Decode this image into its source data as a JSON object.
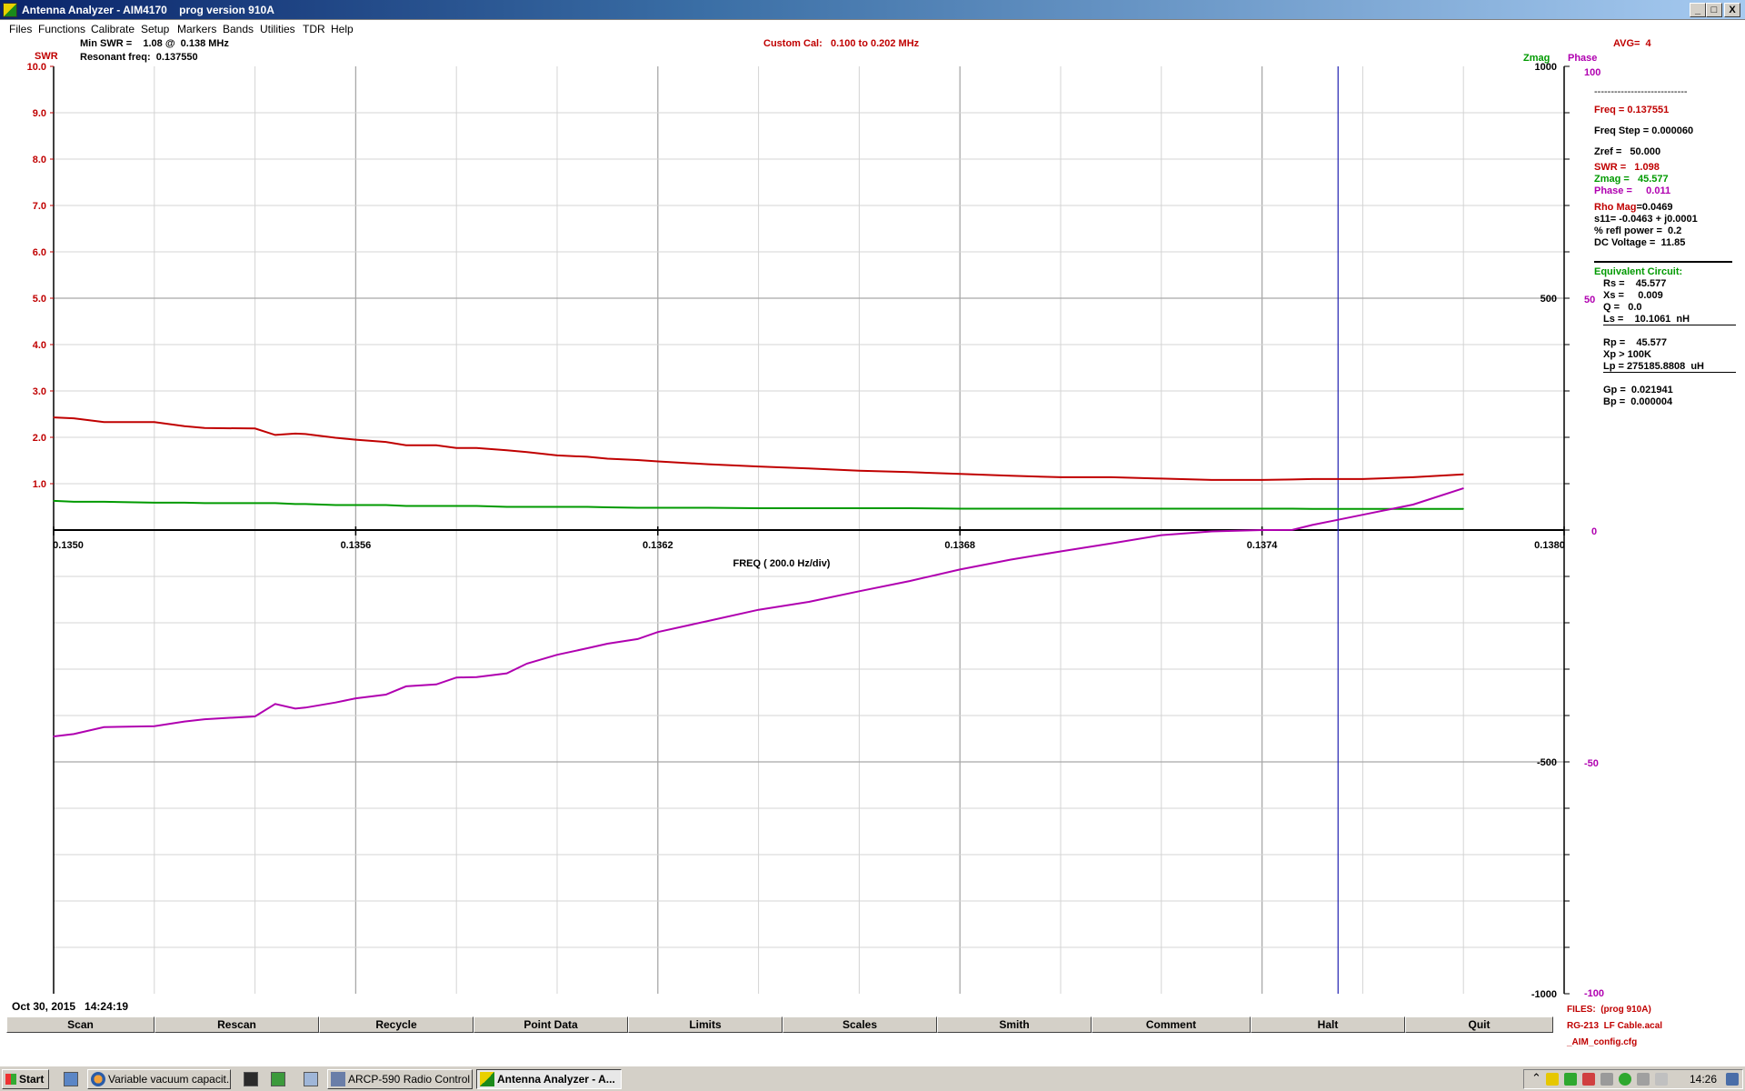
{
  "window": {
    "title": "Antenna Analyzer - AIM4170    prog version 910A",
    "minimize": "_",
    "maximize": "□",
    "close": "X"
  },
  "menu": [
    "Files",
    "Functions",
    "Calibrate",
    "Setup",
    "Markers",
    "Bands",
    "Utilities",
    "TDR",
    "Help"
  ],
  "header": {
    "min_swr": "Min SWR =    1.08 @  0.138 MHz",
    "resonant": "Resonant freq:  0.137550",
    "custom_cal": "Custom Cal:   0.100 to 0.202 MHz",
    "avg": "AVG=  4",
    "swr_axis": "SWR",
    "zmag_axis": "Zmag",
    "phase_axis": "Phase"
  },
  "readout": {
    "dashes": "----------------------------",
    "freq": "Freq = 0.137551",
    "freq_step": "Freq Step = 0.000060",
    "zref": "Zref =   50.000",
    "swr": "SWR =   1.098",
    "zmag": "Zmag =   45.577",
    "phase": "Phase =     0.011",
    "rho_label": "Rho Mag",
    "rho_value": "=0.0469",
    "s11": "s11= -0.0463 + j0.0001",
    "refl": "% refl power =  0.2",
    "dc": "DC Voltage =  11.85",
    "eq_title": "Equivalent Circuit:",
    "rs": "Rs =    45.577",
    "xs": "Xs =     0.009",
    "q": "Q =   0.0",
    "ls": "Ls =    10.1061  nH",
    "rp": "Rp =    45.577",
    "xp": "Xp > 100K",
    "lp": "Lp = 275185.8808  uH",
    "gp": "Gp =  0.021941",
    "bp": "Bp =  0.000004"
  },
  "files": {
    "title": "FILES:  (prog 910A)",
    "cal": "RG-213  LF Cable.acal",
    "cfg": "_AIM_config.cfg"
  },
  "timestamp": "Oct 30, 2015   14:24:19",
  "xlabel": "FREQ ( 200.0 Hz/div)",
  "buttons": [
    "Scan",
    "Rescan",
    "Recycle",
    "Point Data",
    "Limits",
    "Scales",
    "Smith",
    "Comment",
    "Halt",
    "Quit"
  ],
  "taskbar": {
    "start": "Start",
    "tasks": [
      "Variable vacuum capacit...",
      "ARCP-590 Radio Control ...",
      "Antenna Analyzer - A..."
    ],
    "clock": "14:26"
  },
  "colors": {
    "swr": "#c00000",
    "zmag": "#009a00",
    "phase": "#b000b0",
    "marker": "#2020b0",
    "grid": "#c8c8c8"
  },
  "chart_data": {
    "type": "line",
    "x": [
      0.135,
      0.13504,
      0.1351,
      0.1352,
      0.13526,
      0.1353,
      0.1354,
      0.13544,
      0.13548,
      0.1355,
      0.13556,
      0.1356,
      0.13566,
      0.1357,
      0.13576,
      0.1358,
      0.13584,
      0.1359,
      0.13594,
      0.136,
      0.13606,
      0.1361,
      0.13616,
      0.1362,
      0.1363,
      0.1364,
      0.1365,
      0.1366,
      0.1367,
      0.1368,
      0.1369,
      0.137,
      0.1371,
      0.1372,
      0.1373,
      0.1374,
      0.13746,
      0.1375,
      0.13755,
      0.1376,
      0.1377,
      0.1378
    ],
    "xlim": [
      0.135,
      0.138
    ],
    "xticks": [
      "0.1350",
      "0.1356",
      "0.1362",
      "0.1368",
      "0.1374",
      "0.1380"
    ],
    "series": [
      {
        "name": "SWR",
        "axis": "swr",
        "values": [
          2.43,
          2.41,
          2.33,
          2.33,
          2.24,
          2.2,
          2.19,
          2.05,
          2.08,
          2.07,
          1.99,
          1.95,
          1.9,
          1.83,
          1.83,
          1.77,
          1.77,
          1.72,
          1.68,
          1.61,
          1.58,
          1.54,
          1.51,
          1.48,
          1.42,
          1.37,
          1.33,
          1.28,
          1.25,
          1.21,
          1.17,
          1.14,
          1.14,
          1.11,
          1.08,
          1.08,
          1.09,
          1.1,
          1.1,
          1.1,
          1.14,
          1.2
        ]
      },
      {
        "name": "Zmag",
        "axis": "zmag",
        "values": [
          63,
          61,
          61,
          59,
          59,
          58,
          58,
          58,
          56,
          56,
          54,
          54,
          54,
          52,
          52,
          52,
          52,
          50,
          50,
          50,
          50,
          49,
          48,
          48,
          48,
          47,
          47,
          47,
          47,
          46,
          46,
          46,
          46,
          46,
          46,
          46,
          46,
          45.6,
          45.6,
          45.6,
          45.6,
          45.6
        ]
      },
      {
        "name": "Phase",
        "axis": "phase",
        "values": [
          -44.5,
          -44.0,
          -42.5,
          -42.3,
          -41.3,
          -40.8,
          -40.2,
          -37.5,
          -38.5,
          -38.3,
          -37.2,
          -36.3,
          -35.5,
          -33.7,
          -33.3,
          -31.8,
          -31.7,
          -30.9,
          -28.8,
          -26.9,
          -25.5,
          -24.5,
          -23.5,
          -22.0,
          -19.6,
          -17.2,
          -15.5,
          -13.2,
          -11.0,
          -8.5,
          -6.4,
          -4.6,
          -2.9,
          -1.1,
          -0.3,
          0.0,
          0.01,
          1.1,
          2.2,
          3.3,
          5.5,
          9.0
        ]
      }
    ],
    "axes": {
      "swr": {
        "label": "SWR",
        "range": [
          0,
          10.0
        ],
        "ticks": [
          "10.0",
          "9.0",
          "8.0",
          "7.0",
          "6.0",
          "5.0",
          "4.0",
          "3.0",
          "2.0",
          "1.0"
        ]
      },
      "zmag": {
        "label": "Zmag",
        "range": [
          -1000,
          1000
        ],
        "ticks": [
          "1000",
          "500",
          "-500",
          "-1000"
        ]
      },
      "phase": {
        "label": "Phase",
        "range": [
          -100,
          100
        ],
        "ticks": [
          "100",
          "50",
          "0",
          "-50",
          "-100"
        ]
      }
    },
    "marker_freq": 0.137551,
    "grid": true
  }
}
